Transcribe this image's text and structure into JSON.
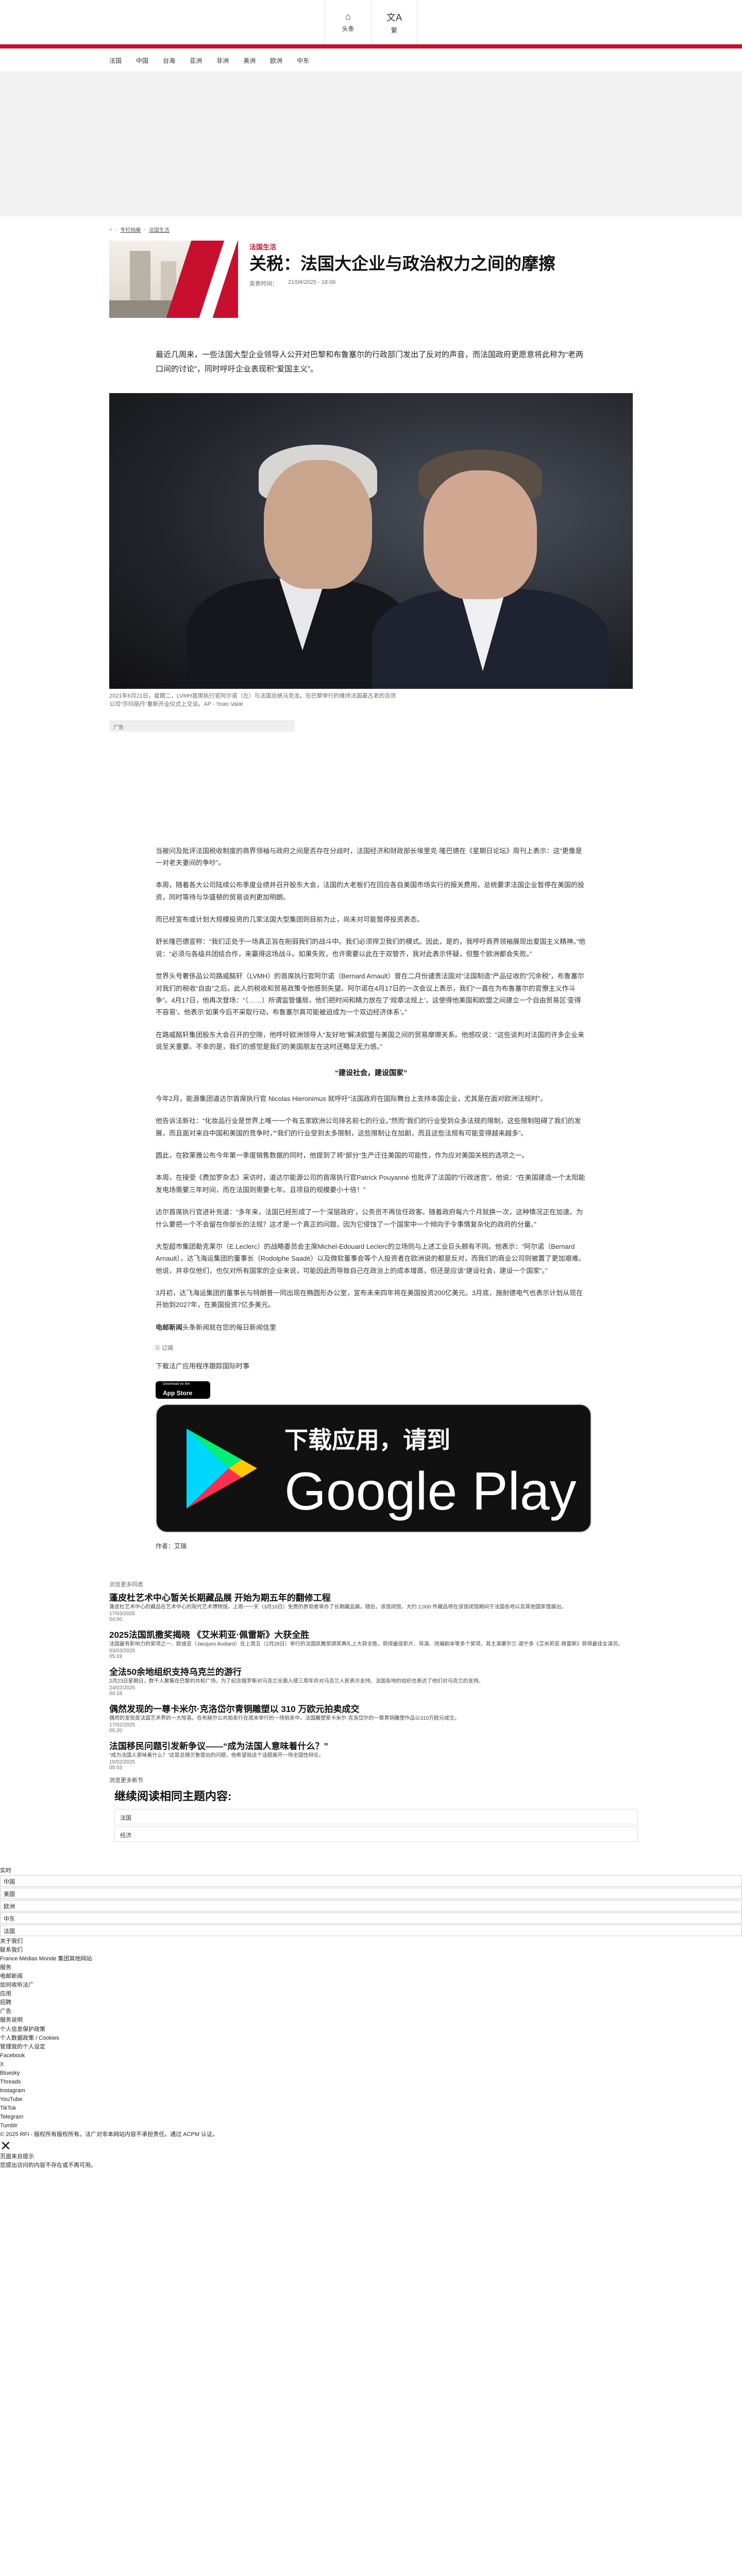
{
  "header": {
    "home_label": "头条",
    "lang_label": "繁",
    "nav": [
      "法国",
      "中国",
      "台海",
      "亚洲",
      "非洲",
      "美洲",
      "欧洲",
      "中东"
    ]
  },
  "breadcrumb": {
    "home_icon": "home-icon",
    "items": [
      "专栏档案",
      "法国生活"
    ]
  },
  "hero": {
    "category": "法国生活",
    "title": "关税：法国大企业与政治权力之间的摩擦",
    "date_label": "发表时间：",
    "date": "21/04/2025 - 18:06"
  },
  "lead": "最近几周来，一些法国大型企业领导人公开对巴黎和布鲁塞尔的行政部门发出了反对的声音，而法国政府更愿意将此称为“老两口间的讨论”，同时呼吁企业表现积“爱国主义”。",
  "photo_caption": "2021年6月21日，星期二，LVMH首席执行官阿尔诺（左）与法国总统马克龙。在巴黎举行的维持法国最古老的百货公司“莎玛丽丹”重新开业仪式上交谈。AP - Yoan Valat",
  "ad_label": "广告",
  "body": {
    "p1": "当被问及批评法国税收制度的商界领袖与政府之间是否存在分歧时，法国经济和财政部长埃里克·隆巴德在《星期日论坛》周刊上表示：这“更像是一对老夫妻间的争吵”。",
    "p2": "本周，随着各大公司陆续公布季度业绩并召开股东大会，法国的大老板们在回应各自美国市场实行的报关费用，总统要求法国企业暂停在美国的投资，同时等待与华盛顿的贸易谈判更加明朗。",
    "p3": "而已经宣布或计划大规模投资的几家法国大型集团则目前为止，尚未对可能暂停投资表态。",
    "p4": "舒长隆巴德宣称：“我们正处于一场真正旨在削弱我们的战斗中。我们必须捍卫我们的模式。因此，是的，我呼吁商界领袖展现出爱国主义精神。”他说：“必须与各级共团结合作，来赢得这场战斗。如果失败，也许需要以此在于双管齐，我对此表示怀疑，但整个欧洲都会失败。”",
    "p5": "世界头号奢侈品公司路威酩轩（LVMH）的首席执行官阿尔诺（Bernard Arnault）曾在二月份谴责法国对“法国制造”产品征收的“冗余税”，布鲁塞尔对我们的税收“自由”之后，此人的税收和贸易政策令他感到失望。阿尔诺在4月17日的一次会议上表示，我们“一直在为布鲁塞尔的官僚主义作斗争”。4月17日，他再次登场：“（……）所谓监管僵局，他们把时间和精力放在了‘规章法规上’，这使得他美国和欧盟之间建立一个自由贸易区‘变得不容易’。他表示‘如果今后不采取行动，布鲁塞尔真可能被迫成为一个双边经济体系’。”",
    "p6": "在路威酩轩集团股东大会召开的空隙，他呼吁欧洲领导人“友好地”解决欧盟与美国之间的贸易摩擦关系。他感叹说：“这些谈判对法国的许多企业来说至关重要。不幸的是，我们的感觉是我们的美国朋友在这时还略显无力感。”",
    "h_subtitle": "“建设社会，建设国家”",
    "p7": "今年2月，能源集团道达尔首席执行官 Nicolas Hieronimus 就呼吁“法国政府在国际舞台上支持本国企业，尤其是在面对欧洲法规时”。",
    "p8": "他告诉法新社：“化妆品行业是世界上唯一一个有五家欧洲公司排名前七的行业。”然而“我们的行业受到众多法规的限制，这些限制阻碍了我们的发展，而且面对来自中国和美国的竞争时，”“我们的行业受到太多限制，这些限制让在加剧，而且这些法规有可能变得越来越多”。",
    "p9": "圆此，在欧莱雅公布今年第一季度销售数据的同时，他提到了将“部分”生产迁往美国的可能性，作为应对美国关税的选项之一。",
    "p10": "本周，在接受《费加罗杂志》采访时，道达尔能源公司的首席执行官Patrick Pouyanné 也批评了法国的“行政迷宫”。他说：“在美国建造一个太阳能发电场需要三年时间，而在法国则需要七年。且项目的规模要小十倍！”",
    "p11": "达尔首席执行官进补充道：“多年来，法国已经形成了一个‘深层政府’，公务员不再信任政客。随着政府每六个月就换一次，这种情况正在加速。为什么要把一个不会留在你部长的法规？这才是一个真正的问题，因为它侵蚀了一个国家中一个倾向于令事情复杂化的政府的分量。”",
    "p12": "大型超市集团勒克莱尔（E.Leclerc）的战略委员会主席Michel-Edouard Leclerc的立场则与上述工业巨头颇有不同。他表示：“阿尔诺（Bernard Arnault），达飞海运集团的董事长（Rodolphe Saadé）以及微软董事会等个人投资者在欧洲说的都是反对，而我们的商业公司则被置了更加艰难。他说，并非仅他们，也仅对所有国家的企业来说，可能因此而导致自己在政治上的成本增高，但还是应该“建设社会，建设一个国家”。”",
    "p13": "3月初，达飞海运集团的董事长与特朗普一同出现在椭圆形办公室，宣布未来四年将在美国投资200亿美元。3月底，施耐德电气也表示计划从现在开始到2027年，在美国投资7亿多美元。",
    "source_bold": "电邮新闻",
    "source_rest": "头条新闻就在您的每日新闻信里",
    "share_label": "订阅",
    "app_line": "下载法广应用程序跟踪国际时事",
    "appstore_t1": "Download on the",
    "appstore_t2": "App Store",
    "gp_line1": "下载应用，请到",
    "gp_line2": "Google Play",
    "author": "作者：艾瑞"
  },
  "related": {
    "title": "浏览更多同类",
    "items": [
      {
        "h": "蓬皮杜艺术中心暂关长期藏品展 开始为期五年的翻修工程",
        "d": "蓬皮杜艺术中心的藏品在艺术中心的现代艺术博物馆。上周一一天（3月10日）免费的参观者举办了长期藏品展。随后，该馆闭馆，大约 2,000 件藏品将在该馆闭馆期间于法国各地以及其他国家借展出。",
        "dt": "17/03/2025",
        "time": "04:50"
      },
      {
        "h": "2025法国凯撒奖揭晓  《艾米莉亚·佩雷斯》大获全胜",
        "d": "法国最有影响力的奖项之一、欧迪亚（Jacques Audiard）在上周五（2月28日）举行的法国凯撒奖颁奖典礼上大获全胜。获得最佳影片、导演、改编剧本等多个奖项，其主演塞尔兰·迦宁多《艾米莉亚·佩雷斯》获得最佳女演员。",
        "dt": "03/03/2025",
        "time": "05:19"
      },
      {
        "h": "全法50余地组织支持乌克兰的游行",
        "d": "2月23日星期日，数千人聚集在巴黎的共和广场，为了纪念俄罗斯对乌克兰全面入侵三周年并对乌克兰人民表示支持。法国各地的组织也表达了他们对乌克兰的支持。",
        "dt": "24/02/2025",
        "time": "04:18"
      },
      {
        "h": "偶然发现的一尊卡米尔·克洛岱尔青铜雕塑以 310 万欧元拍卖成交",
        "d": "偶然的发现是法国艺术界的一大惊喜。在布赫尔公共拍卖行在周末举行的一场拍卖中，法国雕塑家卡米尔·克洛岱尔的一尊青铜雕塑作品以310万欧元成交。",
        "dt": "17/02/2025",
        "time": "05:20"
      },
      {
        "h": "法国移民问题引发新争议——“成为法国人意味着什么？”",
        "d": "“成为法国人意味着什么？”这是总理贝鲁提出的问题，他希望就这个话题展开一场全国性辩论。",
        "dt": "10/02/2025",
        "time": "05:03"
      }
    ],
    "more": "浏览更多新节"
  },
  "topics": {
    "title": "继续阅读相同主题内容:",
    "items": [
      "法国",
      "经济"
    ]
  },
  "footer": {
    "realtime": "实时",
    "regions": [
      "中国",
      "美国",
      "欧洲",
      "中东",
      "法国"
    ],
    "follow": [
      "关于我们",
      "联系我们",
      "RFI Instagram"
    ],
    "links": [
      "简体中文",
      "繁體中文",
      "法文",
      "English"
    ],
    "more": "更多的新语言",
    "links2": [
      "France Médias Monde 集团其他网站"
    ],
    "services": "服务",
    "misc": [
      "电邮新闻",
      "如何收听法广",
      "应用",
      "招聘",
      "广告"
    ],
    "legal": [
      "服务说明",
      "个人信息保护政策",
      "个人数据政策 / Cookies",
      "管理我的个人设定"
    ],
    "social": [
      "Facebook",
      "X",
      "Bluesky",
      "Threads",
      "Instagram",
      "YouTube",
      "TikTok",
      "Telegram",
      "Tumblr"
    ],
    "copyright": "© 2025 RFI - 版权所有版权所有。法广对非本网站内容不承担责任。通过 ACPM 认证。",
    "close_x": "✕",
    "notice_title": "页面来自提示",
    "notice": "您提出访问的内容不存在或不再可用。"
  },
  "colors": {
    "brand_red": "#c8102e"
  }
}
